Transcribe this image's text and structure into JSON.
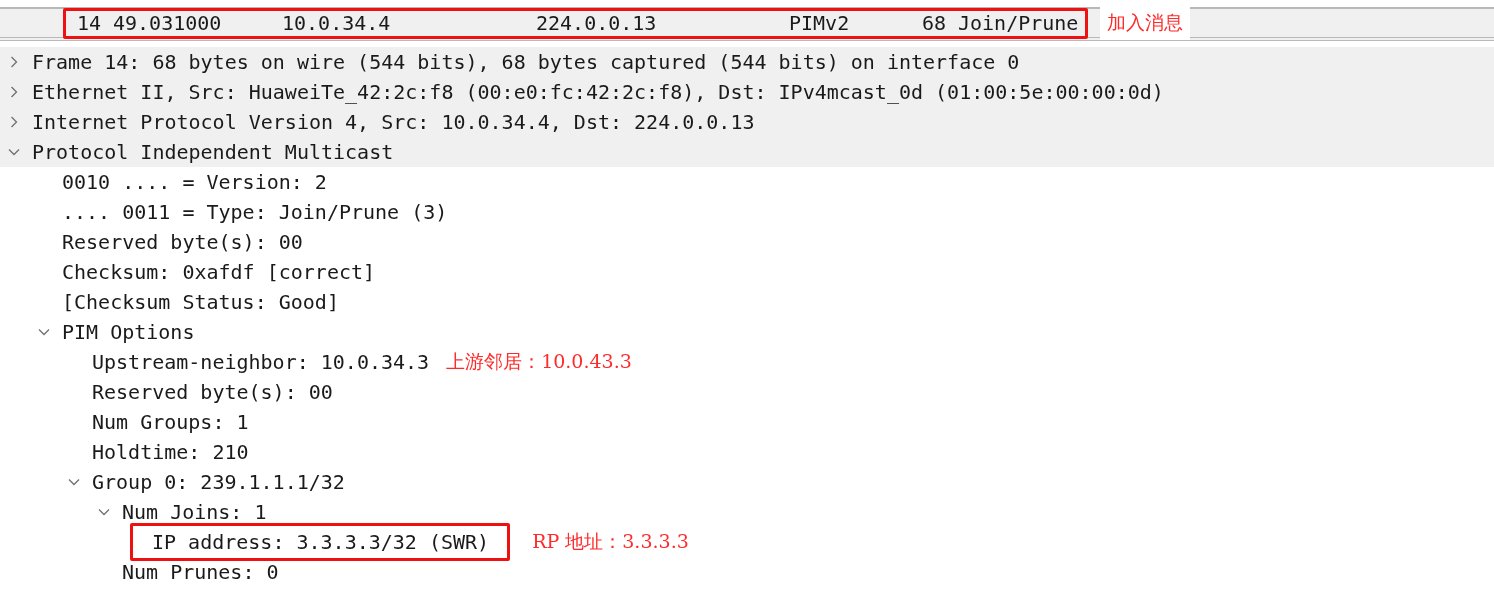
{
  "packet_list": {
    "row": {
      "number": "14",
      "time": "49.031000",
      "source": "10.0.34.4",
      "destination": "224.0.0.13",
      "protocol": "PIMv2",
      "length": "68",
      "info": "Join/Prune",
      "boxed": true,
      "note": "加入消息"
    }
  },
  "details": [
    {
      "text": "Frame 14: 68 bytes on wire (544 bits), 68 bytes captured (544 bits) on interface 0",
      "expanded": false,
      "boxed": false
    },
    {
      "text": "Ethernet II, Src: HuaweiTe_42:2c:f8 (00:e0:fc:42:2c:f8), Dst: IPv4mcast_0d (01:00:5e:00:00:0d)",
      "expanded": false,
      "boxed": false
    },
    {
      "text": "Internet Protocol Version 4, Src: 10.0.34.4, Dst: 224.0.0.13",
      "expanded": false,
      "boxed": false
    },
    {
      "text": "Protocol Independent Multicast",
      "expanded": true,
      "boxed": false,
      "children": [
        {
          "text": "0010 .... = Version: 2",
          "boxed": false
        },
        {
          "text": ".... 0011 = Type: Join/Prune (3)",
          "boxed": false
        },
        {
          "text": "Reserved byte(s): 00",
          "boxed": false
        },
        {
          "text": "Checksum: 0xafdf [correct]",
          "boxed": false
        },
        {
          "text": "[Checksum Status: Good]",
          "boxed": false
        },
        {
          "text": "PIM Options",
          "expanded": true,
          "boxed": false,
          "children": [
            {
              "text": "Upstream-neighbor: 10.0.34.3",
              "boxed": false,
              "note": "上游邻居：10.0.43.3"
            },
            {
              "text": "Reserved byte(s): 00",
              "boxed": false
            },
            {
              "text": "Num Groups: 1",
              "boxed": false
            },
            {
              "text": "Holdtime: 210",
              "boxed": false
            },
            {
              "text": "Group 0: 239.1.1.1/32",
              "expanded": true,
              "boxed": false,
              "children": [
                {
                  "text": "Num Joins: 1",
                  "expanded": true,
                  "boxed": false,
                  "children": [
                    {
                      "text": "IP address: 3.3.3.3/32 (SWR)",
                      "boxed": true,
                      "note": "RP 地址：3.3.3.3"
                    }
                  ]
                },
                {
                  "text": "Num Prunes: 0",
                  "boxed": false
                }
              ]
            }
          ]
        }
      ]
    }
  ]
}
